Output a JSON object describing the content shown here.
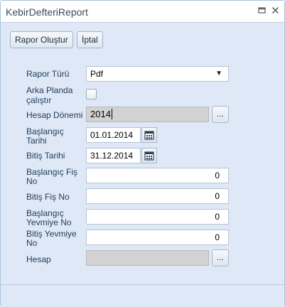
{
  "window": {
    "title": "KebirDefteriReport"
  },
  "toolbar": {
    "create_label": "Rapor Oluştur",
    "cancel_label": "İptal"
  },
  "form": {
    "report_type": {
      "label": "Rapor Türü",
      "value": "Pdf"
    },
    "background": {
      "label_line1": "Arka Planda",
      "label_line2": "çalıştır",
      "checked": false
    },
    "period": {
      "label": "Hesap Dönemi",
      "value": "2014",
      "button": "..."
    },
    "start_date": {
      "label_line1": "Başlangıç",
      "label_line2": "Tarihi",
      "value": "01.01.2014"
    },
    "end_date": {
      "label": "Bitiş Tarihi",
      "value": "31.12.2014"
    },
    "start_receipt": {
      "label_line1": "Başlangıç Fiş",
      "label_line2": "No",
      "value": "0"
    },
    "end_receipt": {
      "label": "Bitiş Fiş No",
      "value": "0"
    },
    "start_journal": {
      "label_line1": "Başlangıç",
      "label_line2": "Yevmiye No",
      "value": "0"
    },
    "end_journal": {
      "label_line1": "Bitiş Yevmiye",
      "label_line2": "No",
      "value": "0"
    },
    "account": {
      "label": "Hesap",
      "value": "",
      "button": "..."
    }
  },
  "icons": {
    "maximize": "maximize-icon",
    "close": "close-icon",
    "dropdown": "chevron-down-icon",
    "calendar": "calendar-icon"
  }
}
